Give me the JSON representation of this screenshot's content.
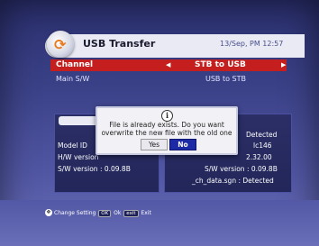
{
  "header": {
    "title": "USB Transfer",
    "datetime": "13/Sep, PM 12:57"
  },
  "menu": {
    "channel_label": "Channel",
    "channel_value": "STB to USB",
    "main_label": "Main S/W",
    "main_value": "USB to STB"
  },
  "left_panel": {
    "model_label": "Model ID",
    "hw_label": "H/W version",
    "sw_label": "S/W version : 0.09.8B"
  },
  "right_panel": {
    "detected_top": "Detected",
    "model_value": "lc146",
    "hw_value": "2.32.00",
    "sw_label": "S/W version : 0.09.8B",
    "chdata_label": "_ch_data.sgn : Detected"
  },
  "dialog": {
    "line1": "File is already exists. Do you want",
    "line2": "overwrite the new file with the old one",
    "yes_label": "Yes",
    "no_label": "No"
  },
  "footer": {
    "change_label": "Change Setting",
    "ok_key": "OK",
    "ok_label": "Ok",
    "exit_key": "exit",
    "exit_label": "Exit"
  }
}
